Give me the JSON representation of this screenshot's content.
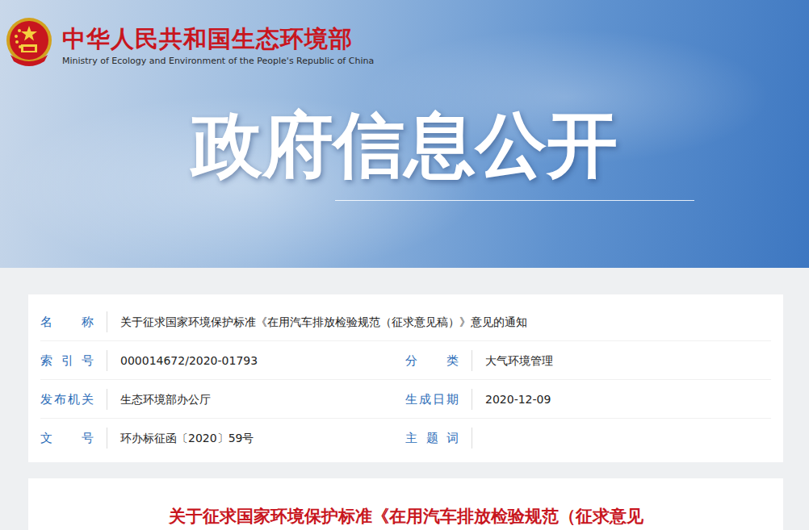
{
  "header": {
    "site_title": "中华人民共和国生态环境部",
    "site_subtitle": "Ministry of Ecology and Environment of the People's Republic of China",
    "banner": "政府信息公开"
  },
  "info": {
    "rows": [
      {
        "fields": [
          {
            "label": "名称",
            "value": "关于征求国家环境保护标准《在用汽车排放检验规范（征求意见稿）》意见的通知"
          }
        ]
      },
      {
        "fields": [
          {
            "label": "索引号",
            "value": "000014672/2020-01793"
          },
          {
            "label": "分类",
            "value": "大气环境管理"
          }
        ]
      },
      {
        "fields": [
          {
            "label": "发布机关",
            "value": "生态环境部办公厅"
          },
          {
            "label": "生成日期",
            "value": "2020-12-09"
          }
        ]
      },
      {
        "fields": [
          {
            "label": "文号",
            "value": "环办标征函〔2020〕59号"
          },
          {
            "label": "主题词",
            "value": ""
          }
        ]
      }
    ]
  },
  "article": {
    "title": "关于征求国家环境保护标准《在用汽车排放检验规范（征求意见"
  }
}
